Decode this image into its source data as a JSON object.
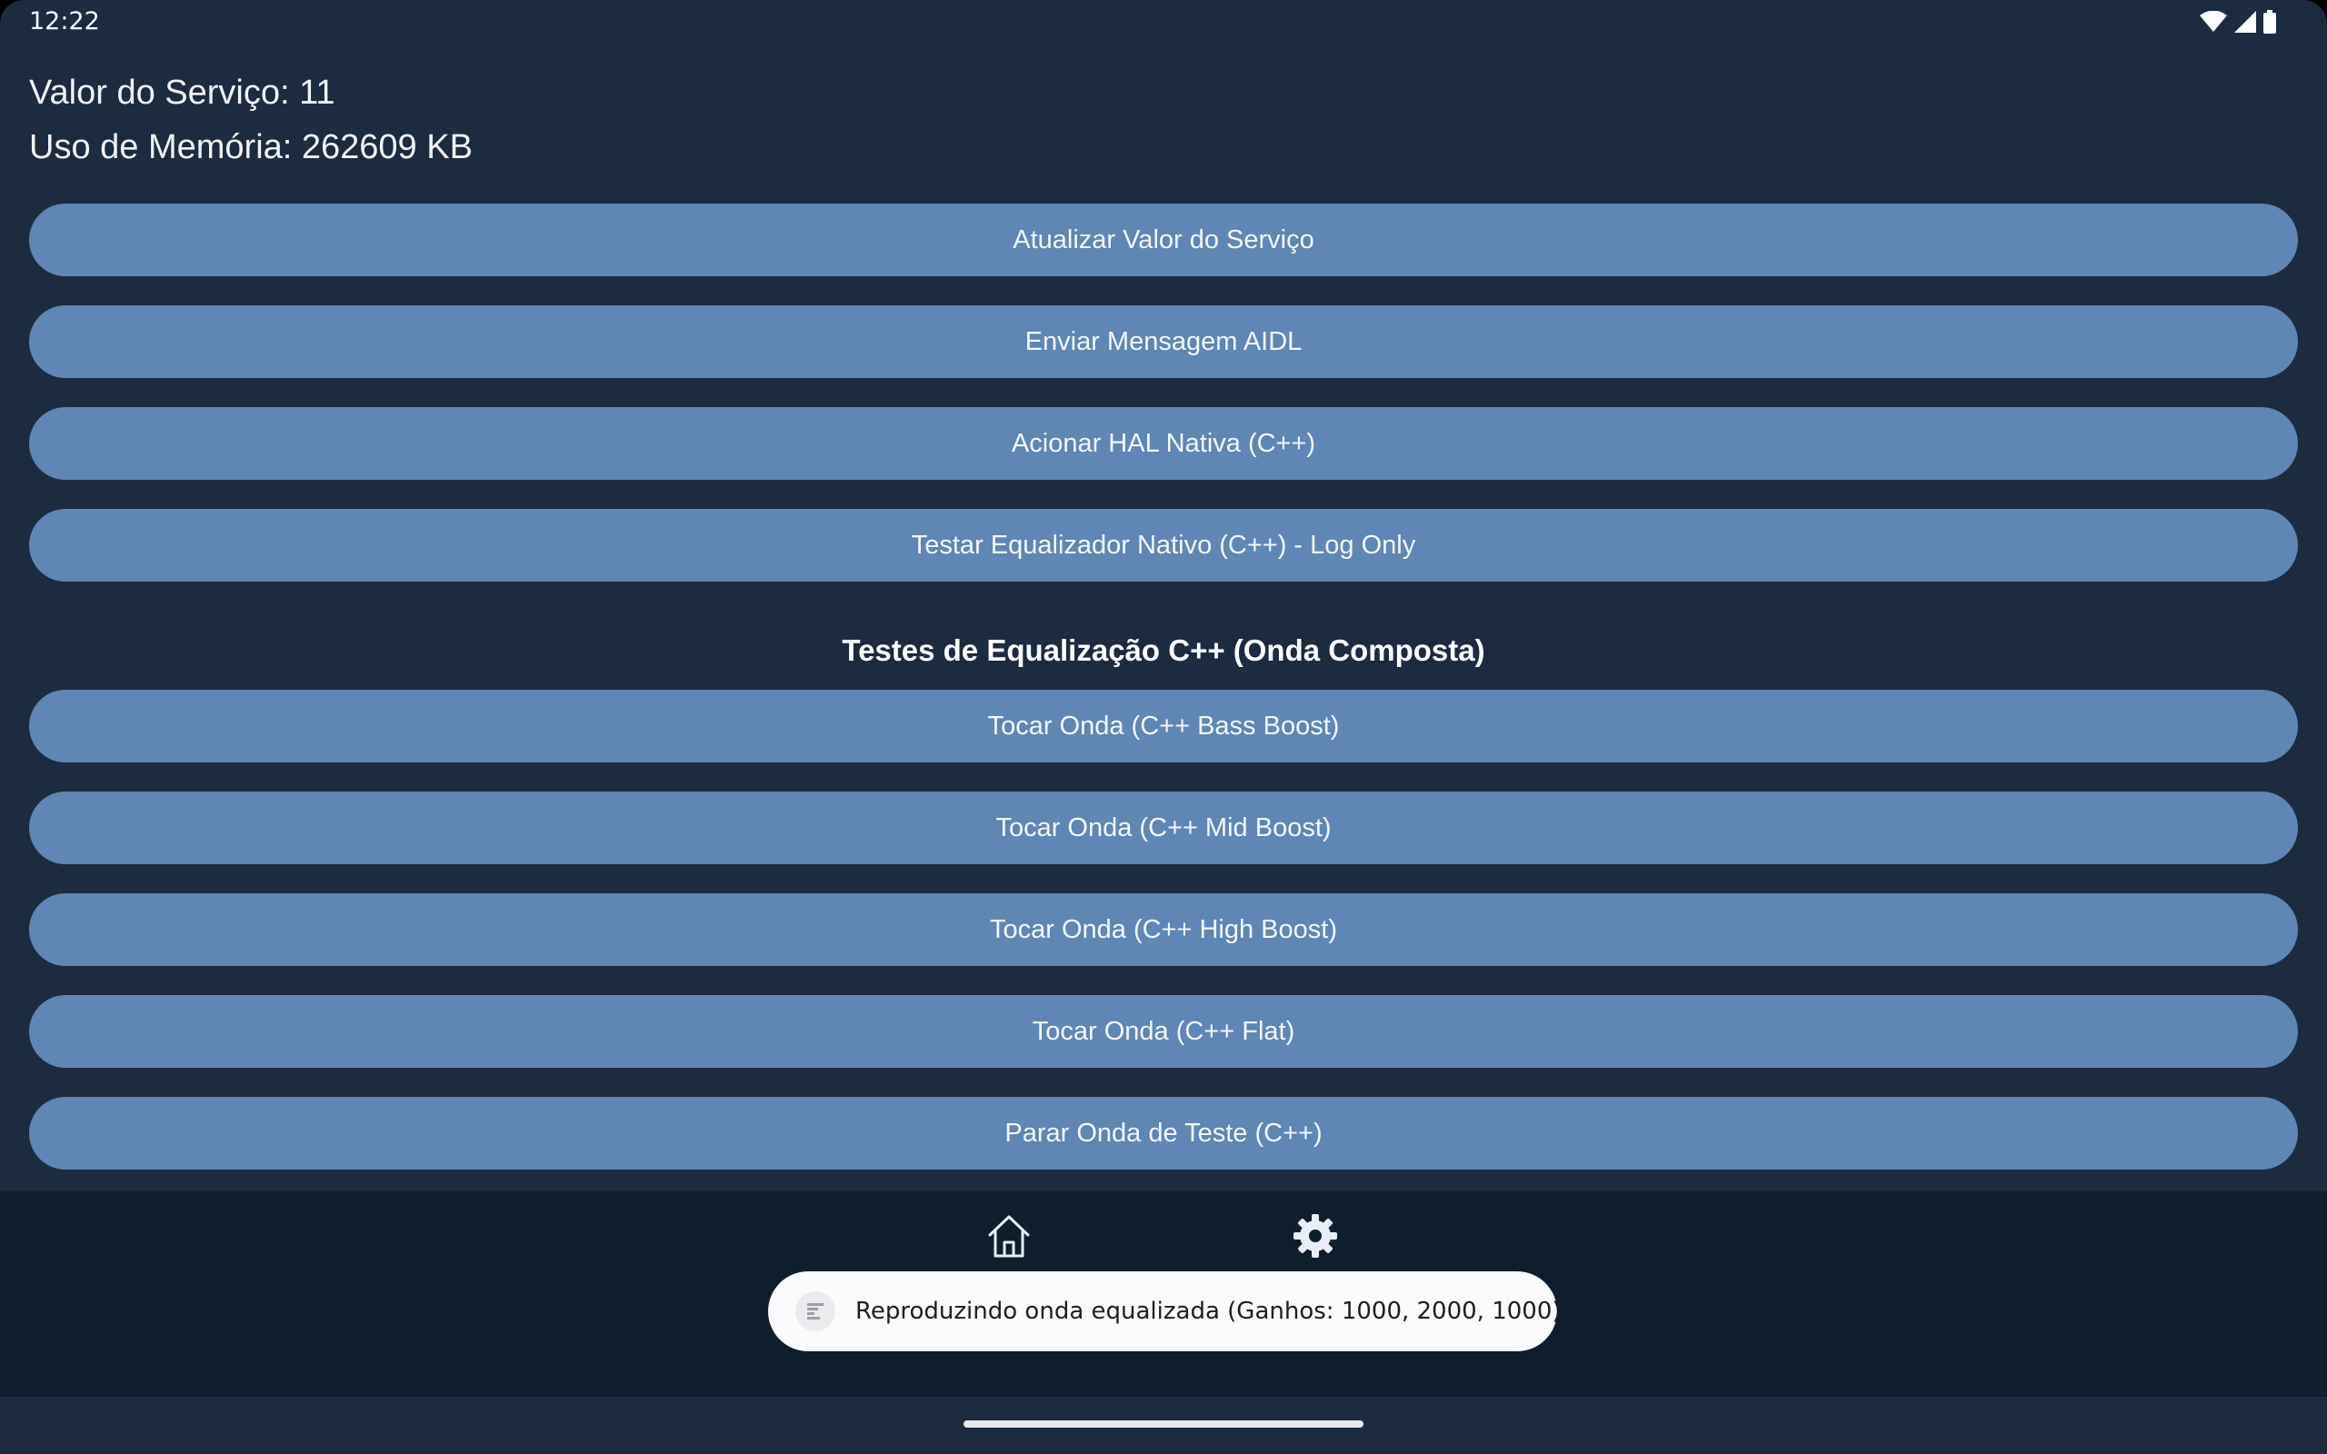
{
  "status_bar": {
    "time": "12:22",
    "icons": [
      "wifi-icon",
      "signal-icon",
      "battery-icon"
    ]
  },
  "info": {
    "service_value": "Valor do Serviço: 11",
    "memory_usage": "Uso de Memória: 262609 KB"
  },
  "buttons_top": [
    {
      "label": "Atualizar Valor do Serviço"
    },
    {
      "label": "Enviar Mensagem AIDL"
    },
    {
      "label": "Acionar HAL Nativa (C++)"
    },
    {
      "label": "Testar Equalizador Nativo (C++) - Log Only"
    }
  ],
  "section": {
    "title": "Testes de Equalização C++ (Onda Composta)"
  },
  "buttons_eq": [
    {
      "label": "Tocar Onda (C++ Bass Boost)"
    },
    {
      "label": "Tocar Onda (C++ Mid Boost)"
    },
    {
      "label": "Tocar Onda (C++ High Boost)"
    },
    {
      "label": "Tocar Onda (C++ Flat)"
    },
    {
      "label": "Parar Onda de Teste (C++)"
    }
  ],
  "bottom_nav": {
    "items": [
      {
        "icon": "home-icon"
      },
      {
        "icon": "gear-icon"
      }
    ]
  },
  "toast": {
    "icon": "app-icon",
    "message": "Reproduzindo onda equalizada (Ganhos: 1000, 2000, 1000)"
  },
  "colors": {
    "background": "#1c2b40",
    "button": "#5f86b4",
    "bottom_nav": "#0f1e2d",
    "toast": "#fbfafd"
  }
}
